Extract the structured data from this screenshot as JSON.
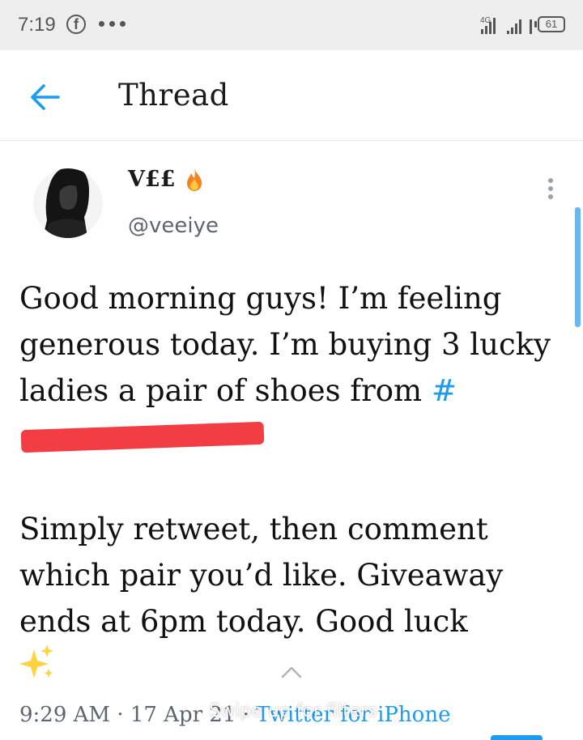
{
  "status_bar": {
    "time": "7:19",
    "network": "4G",
    "battery": "61",
    "icons": [
      "facebook-icon",
      "more-dots-icon",
      "signal-icon",
      "battery-icon"
    ]
  },
  "header": {
    "title": "Thread",
    "back_icon": "back-arrow-icon"
  },
  "tweet": {
    "display_name": "V££",
    "handle": "@veeiye",
    "body": {
      "para1_text": "Good morning guys! I’m feeling generous today. I’m buying 3 lucky ladies a pair of shoes from",
      "hashtag": "#",
      "para2_text": "Simply retweet, then comment which pair you’d like. Giveaway ends at 6pm today. Good luck"
    },
    "timestamp": "9:29 AM · 17 Apr 21 · ",
    "source": "Twitter for iPhone"
  },
  "overlay": {
    "swipe_hint": "Swipe up for filters"
  },
  "colors": {
    "accent": "#1d9bf0",
    "redaction": "#f23d45",
    "status_bar_bg": "#eeeeee",
    "muted_text": "#5b6670"
  }
}
